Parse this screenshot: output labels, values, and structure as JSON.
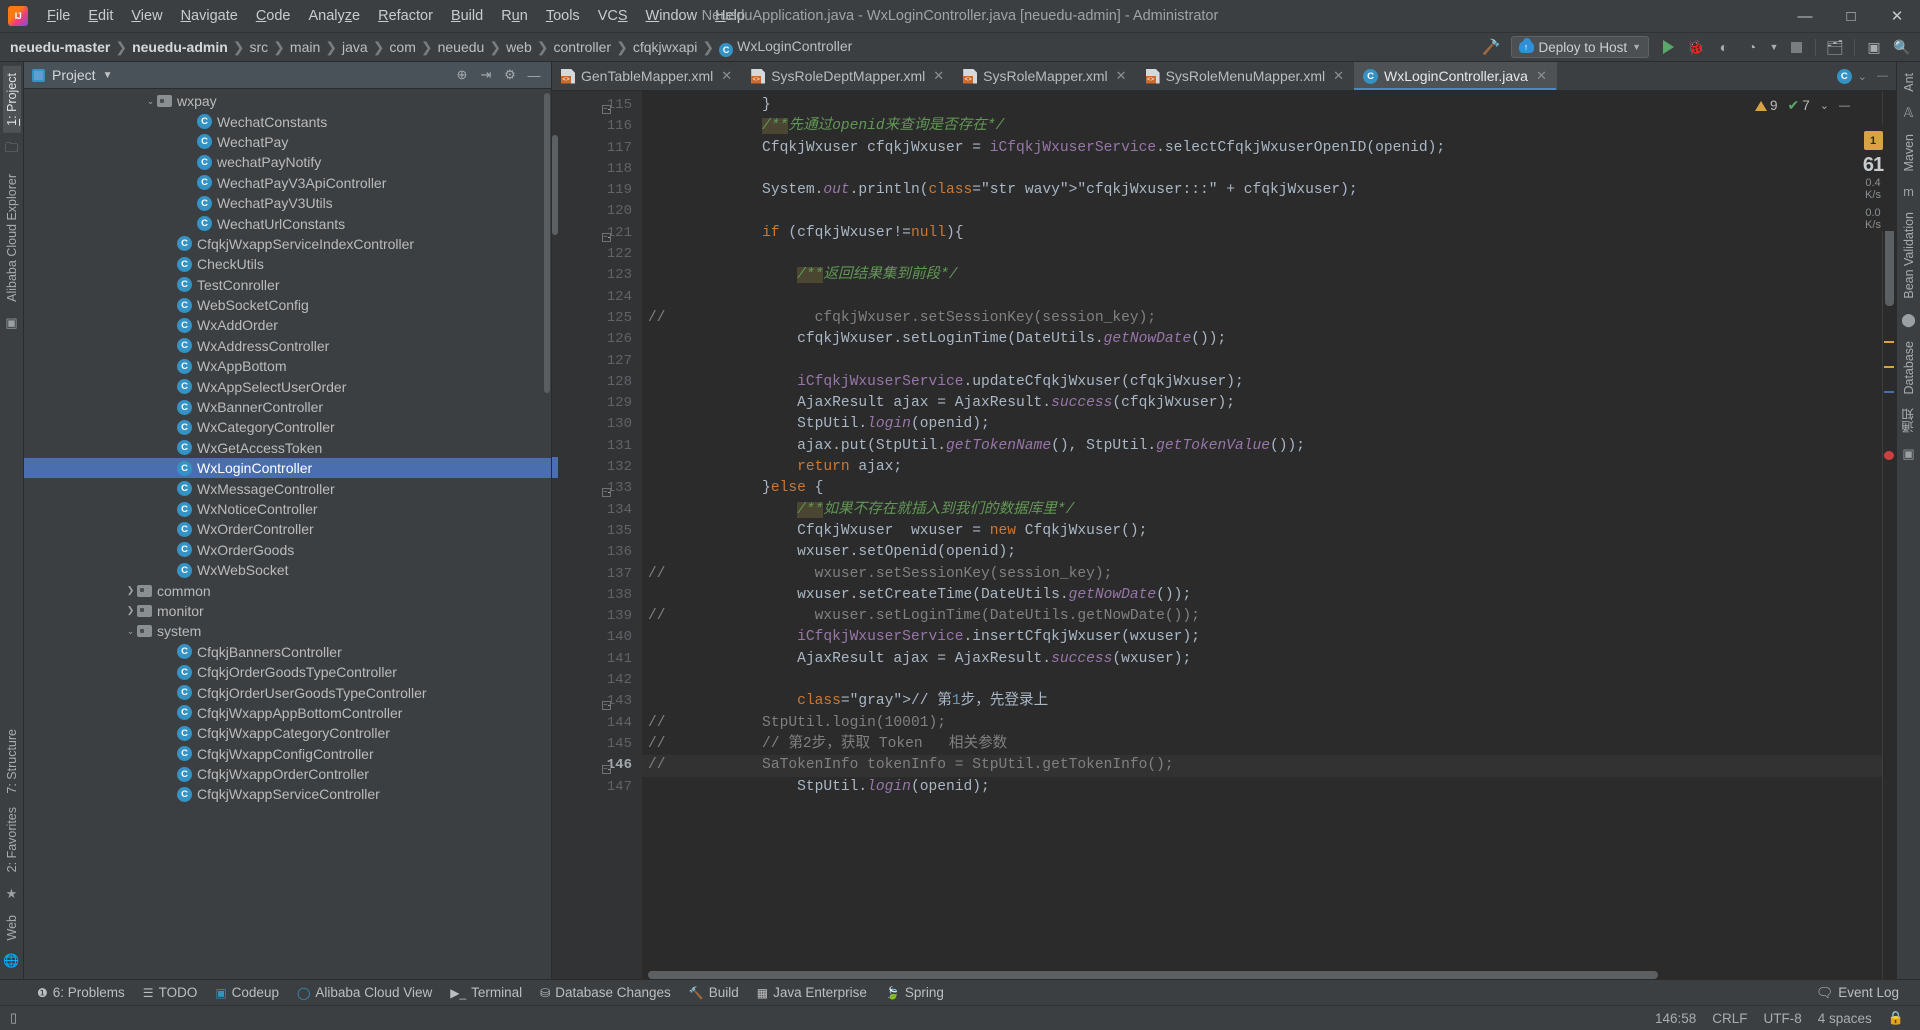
{
  "window": {
    "title": "NeueduApplication.java - WxLoginController.java [neuedu-admin] - Administrator",
    "minimize": "—",
    "maximize": "□",
    "close": "✕",
    "logo": "intellij-idea-logo"
  },
  "menubar": [
    {
      "label": "File"
    },
    {
      "label": "Edit"
    },
    {
      "label": "View"
    },
    {
      "label": "Navigate"
    },
    {
      "label": "Code"
    },
    {
      "label": "Analyze"
    },
    {
      "label": "Refactor"
    },
    {
      "label": "Build"
    },
    {
      "label": "Run"
    },
    {
      "label": "Tools"
    },
    {
      "label": "VCS"
    },
    {
      "label": "Window"
    },
    {
      "label": "Help"
    }
  ],
  "breadcrumbs": [
    {
      "label": "neuedu-master",
      "bold": true
    },
    {
      "label": "neuedu-admin",
      "bold": true
    },
    {
      "label": "src",
      "bold": false
    },
    {
      "label": "main",
      "bold": false
    },
    {
      "label": "java",
      "bold": false
    },
    {
      "label": "com",
      "bold": false
    },
    {
      "label": "neuedu",
      "bold": false
    },
    {
      "label": "web",
      "bold": false
    },
    {
      "label": "controller",
      "bold": false
    },
    {
      "label": "cfqkjwxapi",
      "bold": false
    },
    {
      "label": "WxLoginController",
      "bold": false,
      "class_icon": "C"
    }
  ],
  "toolbar": {
    "run_config": "Deploy to Host",
    "icons": [
      "hammer-icon",
      "run-icon",
      "debug-icon",
      "coverage-icon",
      "profile-icon",
      "stop-icon",
      "project-structure-icon",
      "terminal-icon",
      "search-icon"
    ]
  },
  "left_rail": {
    "project_tab": "1: Project",
    "cloud_tab": "Alibaba Cloud Explorer",
    "structure_tab": "7: Structure",
    "favorites_tab": "2: Favorites",
    "web_tab": "Web"
  },
  "right_rail": {
    "ant_tab": "Ant",
    "maven_tab": "Maven",
    "bean_validation_tab": "Bean Validation",
    "database_tab": "Database",
    "notifications_tab": "通知"
  },
  "project_panel": {
    "title": "Project",
    "tree": [
      {
        "label": "wxpay",
        "type": "folder",
        "indent": 6,
        "arrow": "v"
      },
      {
        "label": "WechatConstants",
        "type": "class",
        "indent": 8,
        "arrow": ""
      },
      {
        "label": "WechatPay",
        "type": "class",
        "indent": 8,
        "arrow": ""
      },
      {
        "label": "wechatPayNotify",
        "type": "class",
        "indent": 8,
        "arrow": ""
      },
      {
        "label": "WechatPayV3ApiController",
        "type": "class",
        "indent": 8,
        "arrow": ""
      },
      {
        "label": "WechatPayV3Utils",
        "type": "class",
        "indent": 8,
        "arrow": ""
      },
      {
        "label": "WechatUrlConstants",
        "type": "class",
        "indent": 8,
        "arrow": ""
      },
      {
        "label": "CfqkjWxappServiceIndexController",
        "type": "class",
        "indent": 7,
        "arrow": ""
      },
      {
        "label": "CheckUtils",
        "type": "class",
        "indent": 7,
        "arrow": ""
      },
      {
        "label": "TestConroller",
        "type": "class",
        "indent": 7,
        "arrow": ""
      },
      {
        "label": "WebSocketConfig",
        "type": "class",
        "indent": 7,
        "arrow": ""
      },
      {
        "label": "WxAddOrder",
        "type": "class",
        "indent": 7,
        "arrow": ""
      },
      {
        "label": "WxAddressController",
        "type": "class",
        "indent": 7,
        "arrow": ""
      },
      {
        "label": "WxAppBottom",
        "type": "class",
        "indent": 7,
        "arrow": ""
      },
      {
        "label": "WxAppSelectUserOrder",
        "type": "class",
        "indent": 7,
        "arrow": ""
      },
      {
        "label": "WxBannerController",
        "type": "class",
        "indent": 7,
        "arrow": ""
      },
      {
        "label": "WxCategoryController",
        "type": "class",
        "indent": 7,
        "arrow": ""
      },
      {
        "label": "WxGetAccessToken",
        "type": "class",
        "indent": 7,
        "arrow": ""
      },
      {
        "label": "WxLoginController",
        "type": "class",
        "indent": 7,
        "arrow": "",
        "selected": true
      },
      {
        "label": "WxMessageController",
        "type": "class",
        "indent": 7,
        "arrow": ""
      },
      {
        "label": "WxNoticeController",
        "type": "class",
        "indent": 7,
        "arrow": ""
      },
      {
        "label": "WxOrderController",
        "type": "class",
        "indent": 7,
        "arrow": ""
      },
      {
        "label": "WxOrderGoods",
        "type": "class",
        "indent": 7,
        "arrow": ""
      },
      {
        "label": "WxWebSocket",
        "type": "class",
        "indent": 7,
        "arrow": ""
      },
      {
        "label": "common",
        "type": "folder",
        "indent": 5,
        "arrow": ">"
      },
      {
        "label": "monitor",
        "type": "folder",
        "indent": 5,
        "arrow": ">"
      },
      {
        "label": "system",
        "type": "folder",
        "indent": 5,
        "arrow": "v"
      },
      {
        "label": "CfqkjBannersController",
        "type": "class",
        "indent": 7,
        "arrow": ""
      },
      {
        "label": "CfqkjOrderGoodsTypeController",
        "type": "class",
        "indent": 7,
        "arrow": ""
      },
      {
        "label": "CfqkjOrderUserGoodsTypeController",
        "type": "class",
        "indent": 7,
        "arrow": ""
      },
      {
        "label": "CfqkjWxappAppBottomController",
        "type": "class",
        "indent": 7,
        "arrow": ""
      },
      {
        "label": "CfqkjWxappCategoryController",
        "type": "class",
        "indent": 7,
        "arrow": ""
      },
      {
        "label": "CfqkjWxappConfigController",
        "type": "class",
        "indent": 7,
        "arrow": ""
      },
      {
        "label": "CfqkjWxappOrderController",
        "type": "class",
        "indent": 7,
        "arrow": ""
      },
      {
        "label": "CfqkjWxappServiceController",
        "type": "class",
        "indent": 7,
        "arrow": ""
      }
    ]
  },
  "editor_tabs": [
    {
      "label": "GenTableMapper.xml",
      "type": "xml",
      "active": false
    },
    {
      "label": "SysRoleDeptMapper.xml",
      "type": "xml",
      "active": false
    },
    {
      "label": "SysRoleMapper.xml",
      "type": "xml",
      "active": false
    },
    {
      "label": "SysRoleMenuMapper.xml",
      "type": "xml",
      "active": false
    },
    {
      "label": "WxLoginController.java",
      "type": "java",
      "active": true
    }
  ],
  "inspection": {
    "warnings": "9",
    "checks": "7",
    "badge": "1",
    "big_number": "61",
    "stat1": "0.4",
    "stat1_unit": "K/s",
    "stat2": "0.0",
    "stat2_unit": "K/s"
  },
  "code": {
    "first_line": 115,
    "current_line": 146,
    "lines": [
      {
        "n": 115,
        "fold": "end",
        "text": "        }"
      },
      {
        "n": 116,
        "text": "        /**先通过openid来查询是否存在*/",
        "kind": "comment-doc"
      },
      {
        "n": 117,
        "text": "        CfqkjWxuser cfqkjWxuser = iCfqkjWxuserService.selectCfqkjWxuserOpenID(openid);"
      },
      {
        "n": 118,
        "text": ""
      },
      {
        "n": 119,
        "text": "        System.out.println(\"cfqkjWxuser:::\" + cfqkjWxuser);"
      },
      {
        "n": 120,
        "text": ""
      },
      {
        "n": 121,
        "fold": "start",
        "text": "        if (cfqkjWxuser!=null){"
      },
      {
        "n": 122,
        "text": ""
      },
      {
        "n": 123,
        "text": "            /**返回结果集到前段*/",
        "kind": "comment-doc"
      },
      {
        "n": 124,
        "text": ""
      },
      {
        "n": 125,
        "commented": true,
        "text": "              cfqkjWxuser.setSessionKey(session_key);"
      },
      {
        "n": 126,
        "text": "            cfqkjWxuser.setLoginTime(DateUtils.getNowDate());"
      },
      {
        "n": 127,
        "text": ""
      },
      {
        "n": 128,
        "text": "            iCfqkjWxuserService.updateCfqkjWxuser(cfqkjWxuser);"
      },
      {
        "n": 129,
        "text": "            AjaxResult ajax = AjaxResult.success(cfqkjWxuser);"
      },
      {
        "n": 130,
        "text": "            StpUtil.login(openid);"
      },
      {
        "n": 131,
        "text": "            ajax.put(StpUtil.getTokenName(), StpUtil.getTokenValue());"
      },
      {
        "n": 132,
        "text": "            return ajax;"
      },
      {
        "n": 133,
        "fold": "end",
        "text": "        }else {"
      },
      {
        "n": 134,
        "text": "            /**如果不存在就插入到我们的数据库里*/",
        "kind": "comment-doc"
      },
      {
        "n": 135,
        "text": "            CfqkjWxuser  wxuser = new CfqkjWxuser();"
      },
      {
        "n": 136,
        "text": "            wxuser.setOpenid(openid);"
      },
      {
        "n": 137,
        "commented": true,
        "text": "              wxuser.setSessionKey(session_key);"
      },
      {
        "n": 138,
        "text": "            wxuser.setCreateTime(DateUtils.getNowDate());"
      },
      {
        "n": 139,
        "commented": true,
        "text": "              wxuser.setLoginTime(DateUtils.getNowDate());"
      },
      {
        "n": 140,
        "text": "            iCfqkjWxuserService.insertCfqkjWxuser(wxuser);"
      },
      {
        "n": 141,
        "text": "            AjaxResult ajax = AjaxResult.success(wxuser);"
      },
      {
        "n": 142,
        "text": ""
      },
      {
        "n": 143,
        "fold": "start",
        "text": "            // 第1步，先登录上"
      },
      {
        "n": 144,
        "commented": true,
        "text": "        StpUtil.login(10001);"
      },
      {
        "n": 145,
        "commented": true,
        "text": "        // 第2步，获取 Token   相关参数"
      },
      {
        "n": 146,
        "commented": true,
        "fold": "end",
        "text": "        SaTokenInfo tokenInfo = StpUtil.getTokenInfo();"
      },
      {
        "n": 147,
        "text": "            StpUtil.login(openid);"
      }
    ]
  },
  "bottom_bar": {
    "items": [
      {
        "label": "6: Problems",
        "icon": "problems-icon"
      },
      {
        "label": "TODO",
        "icon": "todo-icon"
      },
      {
        "label": "Codeup",
        "icon": "codeup-icon"
      },
      {
        "label": "Alibaba Cloud View",
        "icon": "alibaba-cloud-icon"
      },
      {
        "label": "Terminal",
        "icon": "terminal-icon"
      },
      {
        "label": "Database Changes",
        "icon": "database-icon"
      },
      {
        "label": "Build",
        "icon": "build-icon"
      },
      {
        "label": "Java Enterprise",
        "icon": "java-enterprise-icon"
      },
      {
        "label": "Spring",
        "icon": "spring-icon"
      }
    ],
    "event_log": "Event Log"
  },
  "status_bar": {
    "caret": "146:58",
    "line_separator": "CRLF",
    "encoding": "UTF-8",
    "indent": "4 spaces",
    "lock": "lock-icon"
  },
  "colors": {
    "accent_blue": "#4b6eaf",
    "class_icon": "#3592c4",
    "green_run": "#59a869",
    "warning": "#d9a343",
    "error": "#cc4040",
    "editor_bg": "#2b2b2b",
    "panel_bg": "#3c3f41"
  }
}
